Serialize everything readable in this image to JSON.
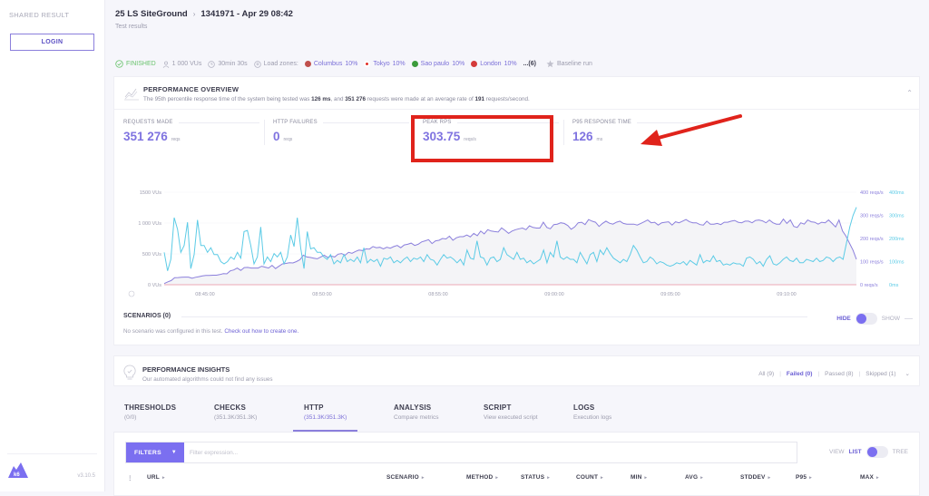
{
  "sidebar": {
    "shared_label": "SHARED RESULT",
    "login_label": "LOGIN",
    "logo_text": "k6",
    "version": "v3.10.5"
  },
  "header": {
    "project": "25 LS SiteGround",
    "run": "1341971 - Apr 29 08:42",
    "subtitle": "Test results"
  },
  "status": {
    "state": "FINISHED",
    "vus": "1 000 VUs",
    "duration": "30min 30s",
    "load_zones_label": "Load zones:",
    "zones": [
      {
        "name": "Columbus",
        "pct": "10%",
        "color": "#c0504d"
      },
      {
        "name": "Tokyo",
        "pct": "10%",
        "color": "#e0231b"
      },
      {
        "name": "Sao paulo",
        "pct": "10%",
        "color": "#3b9b3b"
      },
      {
        "name": "London",
        "pct": "10%",
        "color": "#d43a3a"
      }
    ],
    "more_zones": "...(6)",
    "baseline": "Baseline run"
  },
  "overview": {
    "title": "PERFORMANCE OVERVIEW",
    "desc_parts": [
      "The 95th percentile response time of the system being tested was ",
      "126 ms",
      ", and ",
      "351 276",
      " requests were made at an average rate of ",
      "191",
      " requests/second."
    ],
    "stats": [
      {
        "label": "REQUESTS MADE",
        "value": "351 276",
        "unit": "reqs"
      },
      {
        "label": "HTTP FAILURES",
        "value": "0",
        "unit": "reqs"
      },
      {
        "label": "PEAK RPS",
        "value": "303.75",
        "unit": "reqs/s"
      },
      {
        "label": "P95 RESPONSE TIME",
        "value": "126",
        "unit": "ms"
      }
    ]
  },
  "chart_data": {
    "type": "line",
    "left_axis": {
      "ticks": [
        "0 VUs",
        "500 VUs",
        "1 000 VUs",
        "1500 VUs"
      ],
      "range": [
        0,
        1500
      ]
    },
    "right_axis_rps": {
      "ticks": [
        "0 reqs/s",
        "100 reqs/s",
        "200 reqs/s",
        "300 reqs/s",
        "400 reqs/s"
      ],
      "range": [
        0,
        400
      ]
    },
    "right_axis_ms": {
      "ticks": [
        "0ms",
        "100ms",
        "200ms",
        "300ms",
        "400ms"
      ],
      "range": [
        0,
        400
      ]
    },
    "x_ticks": [
      "08:45:00",
      "08:50:00",
      "08:55:00",
      "09:00:00",
      "09:05:00",
      "09:10:00"
    ],
    "series": [
      {
        "name": "Request rate (reqs/s)",
        "color": "#8b7fdc",
        "axis": "rps",
        "values": [
          5,
          12,
          18,
          30,
          31,
          32,
          33,
          33,
          28,
          32,
          35,
          38,
          40,
          40,
          41,
          41,
          44,
          48,
          47,
          60,
          64,
          72,
          62,
          74,
          75,
          72,
          72,
          72,
          80,
          76,
          72,
          84,
          70,
          80,
          90,
          92,
          95,
          94,
          100,
          108,
          128,
          120,
          118,
          115,
          112,
          120,
          128,
          118,
          124,
          120,
          132,
          135,
          128,
          140,
          136,
          144,
          150,
          148,
          155,
          154,
          165,
          160,
          162,
          155,
          162,
          158,
          165,
          170,
          160,
          172,
          175,
          180,
          170,
          175,
          185,
          190,
          195,
          178,
          190,
          192,
          200,
          198,
          210,
          192,
          203,
          208,
          208,
          215,
          207,
          222,
          212,
          232,
          220,
          238,
          232,
          230,
          228,
          246,
          235,
          222,
          232,
          238,
          242,
          245,
          238,
          255,
          248,
          245,
          245,
          270,
          248,
          242,
          260,
          262,
          268,
          265,
          256,
          240,
          250,
          268,
          270,
          260,
          282,
          275,
          270,
          252,
          265,
          275,
          266,
          262,
          270,
          275,
          265,
          262,
          262,
          262,
          258,
          265,
          272,
          280,
          268,
          270,
          258,
          268,
          270,
          272,
          258,
          272,
          268,
          275,
          282,
          272,
          268,
          268,
          260,
          258,
          275,
          262,
          262,
          265,
          260,
          270,
          270,
          275,
          278,
          270,
          268,
          275,
          275,
          268,
          278,
          280,
          276,
          268,
          280,
          268,
          262,
          262,
          284,
          265,
          280,
          252,
          248,
          268,
          262,
          280,
          272,
          270,
          262,
          270,
          268,
          280,
          265,
          250,
          280,
          232,
          210,
          180,
          150,
          110
        ]
      },
      {
        "name": "Response time (ms)",
        "color": "#5ccbe6",
        "axis": "ms",
        "values": [
          140,
          60,
          110,
          290,
          240,
          140,
          170,
          270,
          70,
          130,
          280,
          170,
          170,
          140,
          160,
          130,
          130,
          100,
          90,
          100,
          120,
          110,
          140,
          115,
          230,
          235,
          170,
          90,
          120,
          250,
          90,
          120,
          100,
          135,
          120,
          140,
          90,
          120,
          215,
          165,
          290,
          160,
          70,
          230,
          155,
          160,
          140,
          140,
          120,
          110,
          130,
          90,
          105,
          95,
          130,
          100,
          110,
          100,
          120,
          95,
          160,
          95,
          110,
          100,
          110,
          80,
          115,
          110,
          120,
          95,
          105,
          95,
          110,
          120,
          100,
          115,
          110,
          120,
          100,
          130,
          110,
          105,
          85,
          110,
          130,
          115,
          120,
          110,
          95,
          110,
          85,
          150,
          115,
          110,
          190,
          120,
          115,
          85,
          115,
          120,
          100,
          110,
          160,
          130,
          120,
          110,
          140,
          110,
          115,
          95,
          105,
          90,
          100,
          110,
          150,
          95,
          140,
          120,
          190,
          120,
          110,
          120,
          110,
          110,
          95,
          140,
          115,
          90,
          130,
          140,
          100,
          150,
          130,
          160,
          135,
          115,
          105,
          95,
          110,
          100,
          130,
          170,
          150,
          120,
          95,
          100,
          120,
          110,
          90,
          100,
          95,
          85,
          80,
          85,
          95,
          90,
          100,
          85,
          105,
          95,
          85,
          130,
          95,
          105,
          100,
          125,
          100,
          105,
          85,
          90,
          85,
          95,
          90,
          90,
          80,
          115,
          120,
          110,
          90,
          100,
          80,
          110,
          125,
          90,
          85,
          95,
          110,
          120,
          105,
          100,
          115,
          95,
          95,
          110,
          105,
          100,
          115,
          100,
          105,
          120,
          115,
          100,
          115,
          120,
          110,
          180,
          250,
          300,
          335
        ]
      },
      {
        "name": "Failed requests",
        "color": "#e88fa0",
        "axis": "rps",
        "values": [
          0,
          0
        ]
      }
    ]
  },
  "scenarios": {
    "title": "SCENARIOS (0)",
    "desc": "No scenario was configured in this test.",
    "link": "Check out how to create one.",
    "hide": "HIDE",
    "show": "SHOW"
  },
  "insights": {
    "title": "PERFORMANCE INSIGHTS",
    "desc": "Our automated algorithms could not find any issues",
    "filters": [
      "All (9)",
      "Failed (0)",
      "Passed (8)",
      "Skipped (1)"
    ]
  },
  "tabs": [
    {
      "name": "THRESHOLDS",
      "sub": "(0/0)"
    },
    {
      "name": "CHECKS",
      "sub": "(351.3K/351.3K)"
    },
    {
      "name": "HTTP",
      "sub": "(351.3K/351.3K)"
    },
    {
      "name": "ANALYSIS",
      "sub": "Compare metrics"
    },
    {
      "name": "SCRIPT",
      "sub": "View executed script"
    },
    {
      "name": "LOGS",
      "sub": "Execution logs"
    }
  ],
  "table": {
    "filters_label": "FILTERS",
    "filter_placeholder": "Filter expression...",
    "view_label": "VIEW",
    "list_label": "LIST",
    "tree_label": "TREE",
    "columns": [
      "URL",
      "SCENARIO",
      "METHOD",
      "STATUS",
      "COUNT",
      "MIN",
      "AVG",
      "STDDEV",
      "P95",
      "MAX"
    ]
  }
}
